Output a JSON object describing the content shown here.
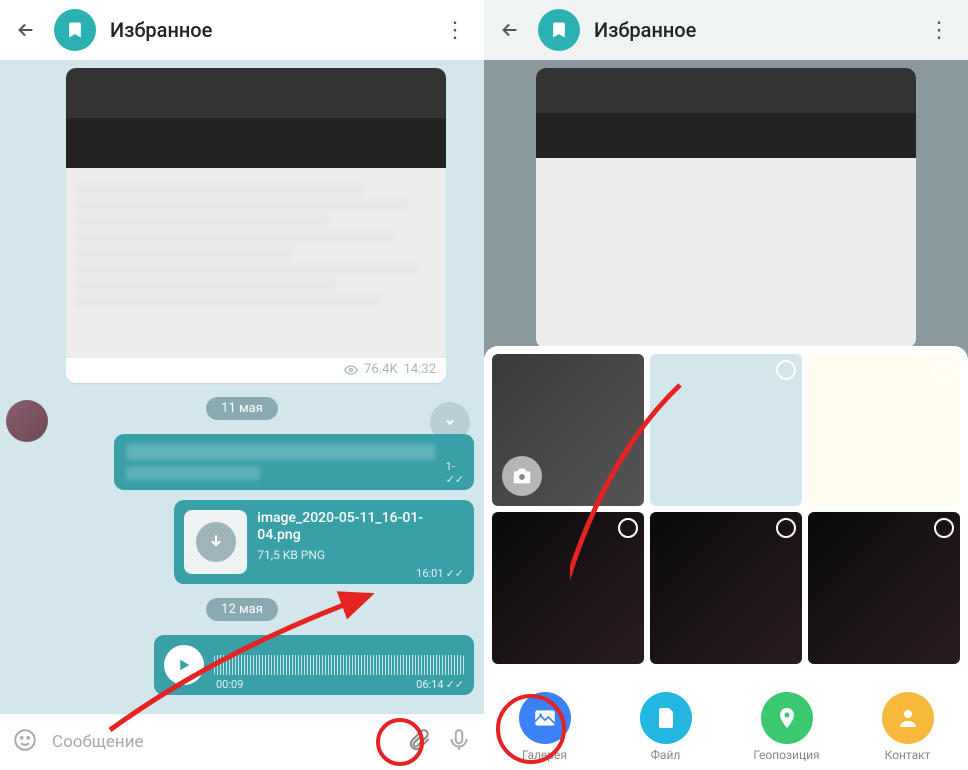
{
  "header": {
    "title": "Избранное"
  },
  "left": {
    "views": "76.4K",
    "msg_time": "14:32",
    "date1": "11 мая",
    "date2": "12 мая",
    "file": {
      "name": "image_2020-05-11_16-01-04.png",
      "size": "71,5 KB PNG",
      "time": "16:01"
    },
    "voice": {
      "elapsed": "00:09",
      "time": "06:14"
    },
    "input_placeholder": "Сообщение"
  },
  "right": {
    "tabs": {
      "gallery": "Галерея",
      "file": "Файл",
      "geo": "Геопозиция",
      "contact": "Контакт"
    }
  }
}
